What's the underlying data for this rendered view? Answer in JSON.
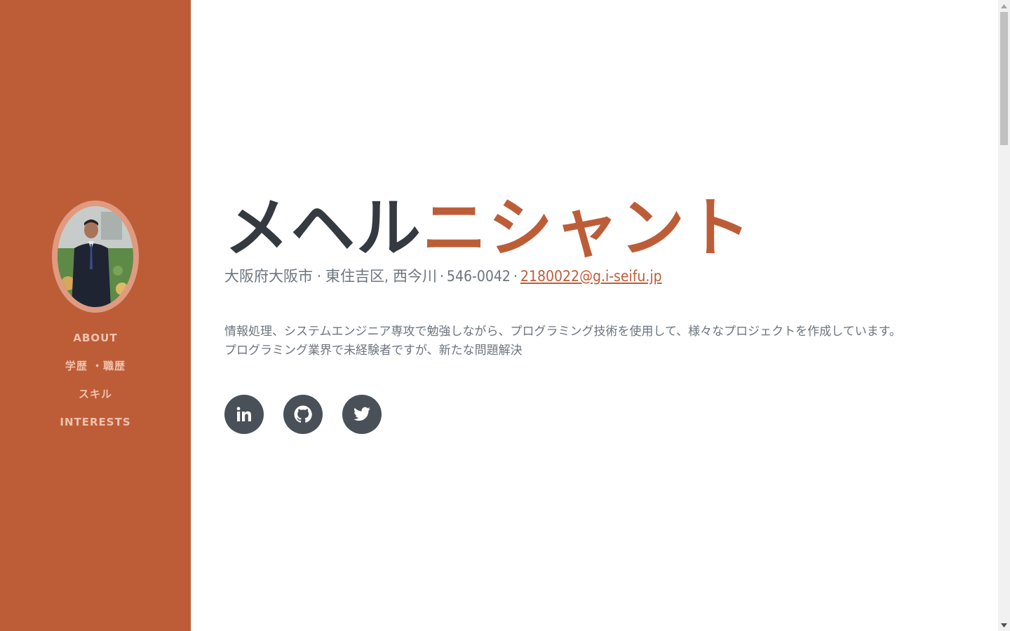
{
  "sidebar": {
    "nav": [
      {
        "label": "ABOUT"
      },
      {
        "label": "学歴 ・職歴"
      },
      {
        "label": "スキル"
      },
      {
        "label": "INTERESTS"
      }
    ]
  },
  "main": {
    "name_first": "メヘル",
    "name_last": "ニシャント",
    "address": "大阪府大阪市 · 東住吉区, 西今川",
    "postal": "546-0042",
    "email": "2180022@g.i-seifu.jp",
    "bio_line1": "情報処理、システムエンジニア専攻で勉強しながら、プログラミング技術を使用して、様々なプロジェクトを作成しています。",
    "bio_line2": "プログラミング業界で未経験者ですが、新たな問題解決"
  },
  "social": [
    {
      "icon": "linkedin-icon"
    },
    {
      "icon": "github-icon"
    },
    {
      "icon": "twitter-icon"
    }
  ],
  "colors": {
    "accent": "#bd5d38",
    "dark": "#343a40",
    "muted": "#6c757d",
    "social_bg": "#495057",
    "nav_text": "#f0c2ae"
  }
}
